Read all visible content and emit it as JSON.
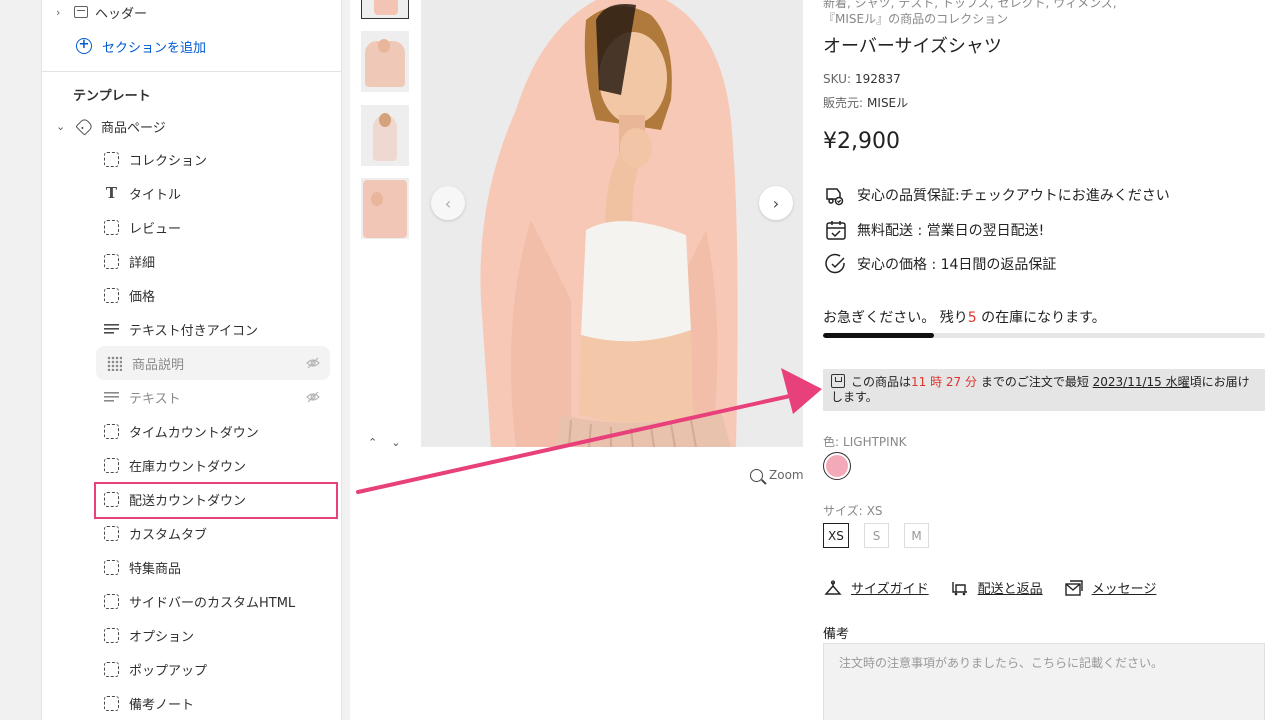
{
  "sidebar": {
    "header_label": "ヘッダー",
    "add_section": "セクションを追加",
    "template_title": "テンプレート",
    "product_page": "商品ページ",
    "blocks": [
      {
        "label": "コレクション",
        "icon": "dashed-block-icon",
        "hidden": false
      },
      {
        "label": "タイトル",
        "icon": "text-T-icon",
        "hidden": false
      },
      {
        "label": "レビュー",
        "icon": "dashed-block-icon",
        "hidden": false
      },
      {
        "label": "詳細",
        "icon": "dashed-block-icon",
        "hidden": false
      },
      {
        "label": "価格",
        "icon": "dashed-block-icon",
        "hidden": false
      },
      {
        "label": "テキスト付きアイコン",
        "icon": "text-lines-icon",
        "hidden": false
      },
      {
        "label": "商品説明",
        "icon": "drag-handle-icon",
        "hidden": true
      },
      {
        "label": "テキスト",
        "icon": "text-lines-icon",
        "hidden": true
      },
      {
        "label": "タイムカウントダウン",
        "icon": "dashed-block-icon",
        "hidden": false
      },
      {
        "label": "在庫カウントダウン",
        "icon": "dashed-block-icon",
        "hidden": false
      },
      {
        "label": "配送カウントダウン",
        "icon": "dashed-block-icon",
        "hidden": false,
        "highlighted": true
      },
      {
        "label": "カスタムタブ",
        "icon": "dashed-block-icon",
        "hidden": false
      },
      {
        "label": "特集商品",
        "icon": "dashed-block-icon",
        "hidden": false
      },
      {
        "label": "サイドバーのカスタムHTML",
        "icon": "dashed-block-icon",
        "hidden": false
      },
      {
        "label": "オプション",
        "icon": "dashed-block-icon",
        "hidden": false
      },
      {
        "label": "ポップアップ",
        "icon": "dashed-block-icon",
        "hidden": false
      },
      {
        "label": "備考ノート",
        "icon": "dashed-block-icon",
        "hidden": false
      }
    ]
  },
  "gallery": {
    "zoom_label": "Zoom",
    "prev_icon": "chevron-left-icon",
    "next_icon": "chevron-right-icon"
  },
  "product": {
    "collection_line": "新着, シャツ, テスト, トップス, セレクト, ウィメンズ, 『MISEル』の商品のコレクション",
    "title": "オーバーサイズシャツ",
    "sku_label": "SKU:",
    "sku": "192837",
    "vendor_label": "販売元:",
    "vendor": "MISEル",
    "price": "¥2,900",
    "features": [
      {
        "icon": "quality-check-icon",
        "text": "安心の品質保証:チェックアウトにお進みください"
      },
      {
        "icon": "calendar-icon",
        "text": "無料配送 : 営業日の翌日配送!"
      },
      {
        "icon": "price-check-icon",
        "text": "安心の価格 : 14日間の返品保証"
      }
    ],
    "stock": {
      "prefix": "お急ぎください。 残り",
      "count": "5",
      "suffix": " の在庫になります。",
      "fill_fraction": 0.25
    },
    "delivery": {
      "prefix": "この商品は",
      "countdown": "11 時 27 分",
      "middle": " までのご注文で最短 ",
      "date": "2023/11/15 水曜",
      "suffix": "頃にお届けします。"
    },
    "color_label": "色:",
    "color_value": "LIGHTPINK",
    "swatch_color": "#f4a9b8",
    "size_label": "サイズ:",
    "size_value": "XS",
    "sizes": [
      "XS",
      "S",
      "M"
    ],
    "selected_size": "XS",
    "links": [
      {
        "icon": "size-guide-icon",
        "label": "サイズガイド"
      },
      {
        "icon": "shipping-icon",
        "label": "配送と返品"
      },
      {
        "icon": "message-icon",
        "label": "メッセージ"
      }
    ],
    "note_label": "備考",
    "note_placeholder": "注文時の注意事項がありましたら、こちらに記載ください。"
  },
  "colors": {
    "accent_link": "#005bd3",
    "annotation_pink": "#e8407a",
    "countdown_red": "#e0322e"
  }
}
